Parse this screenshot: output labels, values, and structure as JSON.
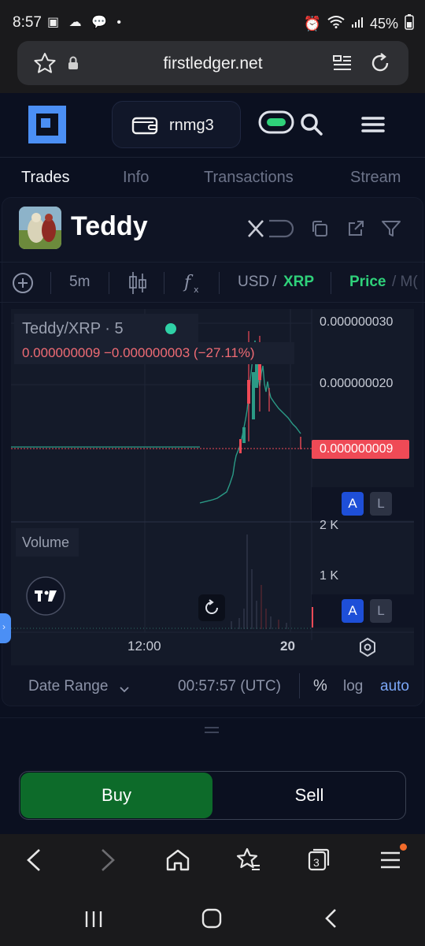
{
  "status": {
    "time": "8:57",
    "battery": "45%"
  },
  "browser": {
    "url": "firstledger.net",
    "tab_count": "3"
  },
  "header": {
    "wallet_label": "rnmg3"
  },
  "tabs": [
    {
      "label": "Trades"
    },
    {
      "label": "Info"
    },
    {
      "label": "Transactions"
    },
    {
      "label": "Stream"
    }
  ],
  "token": {
    "name": "Teddy"
  },
  "toolbar": {
    "interval": "5m",
    "currency_base": "USD",
    "currency_sep": "/",
    "currency_quote": "XRP",
    "price_label": "Price",
    "next_label_fragment": "/ M("
  },
  "chart": {
    "legend_title": "Teddy/XRP · 5",
    "legend_values": "0.000000009  −0.000000003 (−27.11%)",
    "price_ticks": [
      "0.000000030",
      "0.000000020"
    ],
    "current_price": "0.000000009",
    "volume_label": "Volume",
    "volume_ticks": [
      "2 K",
      "1 K"
    ],
    "time_ticks": [
      "12:00",
      "20"
    ],
    "scale_buttons": {
      "a": "A",
      "l": "L"
    }
  },
  "datebar": {
    "date_range": "Date Range",
    "clock": "00:57:57 (UTC)",
    "percent": "%",
    "log": "log",
    "auto": "auto"
  },
  "trade": {
    "buy_label": "Buy",
    "sell_label": "Sell"
  },
  "colors": {
    "accent_green": "#2fd17a",
    "buy": "#0d6b2a",
    "loss": "#ef4a56",
    "brand_blue": "#4b8ff5"
  },
  "chart_data": {
    "type": "candlestick",
    "title": "Teddy/XRP · 5",
    "x_ticks": [
      "12:00",
      "20"
    ],
    "y_ticks": [
      3e-08,
      2e-08
    ],
    "last_price": 9e-09,
    "change": -3e-09,
    "change_pct": -27.11,
    "volume_ticks": [
      "2 K",
      "1 K"
    ]
  }
}
